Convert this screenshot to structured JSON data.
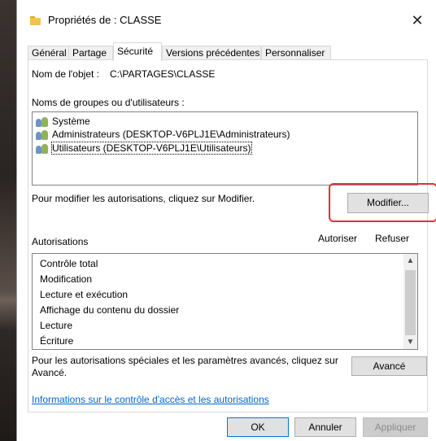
{
  "window": {
    "title": "Propriétés de : CLASSE",
    "close_symbol": "✕"
  },
  "tabs": [
    {
      "label": "Général",
      "active": false
    },
    {
      "label": "Partage",
      "active": false
    },
    {
      "label": "Sécurité",
      "active": true
    },
    {
      "label": "Versions précédentes",
      "active": false
    },
    {
      "label": "Personnaliser",
      "active": false
    }
  ],
  "object": {
    "label": "Nom de l'objet :",
    "value": "C:\\PARTAGES\\CLASSE"
  },
  "groups": {
    "label": "Noms de groupes ou d'utilisateurs :",
    "items": [
      {
        "label": "Système",
        "icon": "users-icon",
        "selected": false
      },
      {
        "label": "Administrateurs (DESKTOP-V6PLJ1E\\Administrateurs)",
        "icon": "users-icon",
        "selected": false
      },
      {
        "label": "Utilisateurs (DESKTOP-V6PLJ1E\\Utilisateurs)",
        "icon": "users-icon",
        "selected": true
      }
    ]
  },
  "modify": {
    "hint": "Pour modifier les autorisations, cliquez sur Modifier.",
    "button": "Modifier..."
  },
  "permissions": {
    "label": "Autorisations",
    "allow_header": "Autoriser",
    "deny_header": "Refuser",
    "items": [
      "Contrôle total",
      "Modification",
      "Lecture et exécution",
      "Affichage du contenu du dossier",
      "Lecture",
      "Écriture"
    ]
  },
  "advanced": {
    "hint_line1": "Pour les autorisations spéciales et les paramètres avancés, cliquez sur",
    "hint_line2": "Avancé.",
    "button": "Avancé"
  },
  "info_link": "Informations sur le contrôle d'accès et les autorisations",
  "footer": {
    "ok": "OK",
    "cancel": "Annuler",
    "apply": "Appliquer"
  },
  "colors": {
    "highlight": "#e0303a",
    "link": "#0066cc",
    "default_button_border": "#0078d7"
  }
}
